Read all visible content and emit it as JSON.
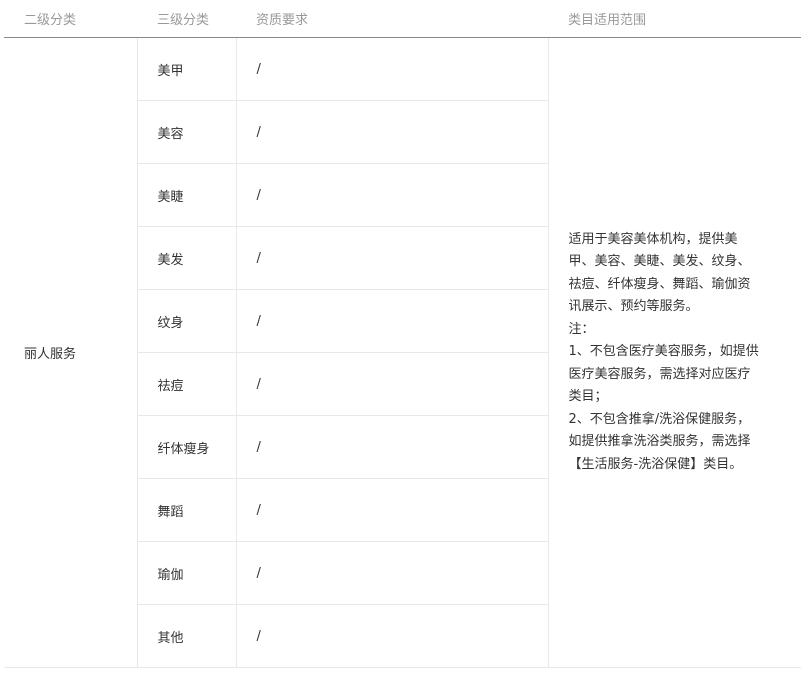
{
  "header": {
    "level2": "二级分类",
    "level3": "三级分类",
    "qualification": "资质要求",
    "scope": "类目适用范围"
  },
  "category": "丽人服务",
  "subcategories": [
    {
      "name": "美甲",
      "qualification": "/"
    },
    {
      "name": "美容",
      "qualification": "/"
    },
    {
      "name": "美睫",
      "qualification": "/"
    },
    {
      "name": "美发",
      "qualification": "/"
    },
    {
      "name": "纹身",
      "qualification": "/"
    },
    {
      "name": "祛痘",
      "qualification": "/"
    },
    {
      "name": "纤体瘦身",
      "qualification": "/"
    },
    {
      "name": "舞蹈",
      "qualification": "/"
    },
    {
      "name": "瑜伽",
      "qualification": "/"
    },
    {
      "name": "其他",
      "qualification": "/"
    }
  ],
  "scope_lines": [
    "适用于美容美体机构，提供美",
    "甲、美容、美睫、美发、纹身、",
    "祛痘、纤体瘦身、舞蹈、瑜伽资",
    "讯展示、预约等服务。",
    "注：",
    "1、不包含医疗美容服务，如提供",
    "医疗美容服务，需选择对应医疗",
    "类目；",
    "2、不包含推拿/洗浴保健服务，",
    "如提供推拿洗浴类服务，需选择",
    "【生活服务-洗浴保健】类目。"
  ]
}
